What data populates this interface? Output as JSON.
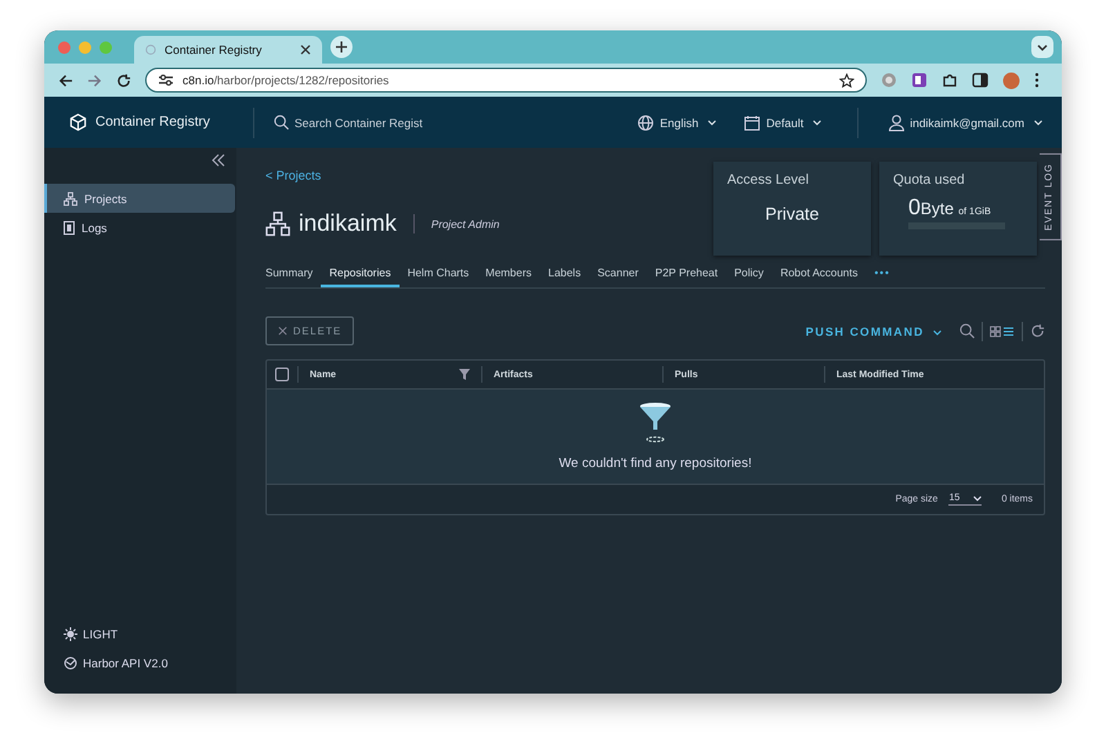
{
  "browser": {
    "tab_title": "Container Registry",
    "url_domain": "c8n.io",
    "url_path": "/harbor/projects/1282/repositories"
  },
  "header": {
    "app_name": "Container Registry",
    "search": {
      "placeholder": "Search Container Regist"
    },
    "language": "English",
    "theme_menu": "Default",
    "user": "indikaimk@gmail.com"
  },
  "sidebar": {
    "items": [
      {
        "label": "Projects",
        "selected": true
      },
      {
        "label": "Logs",
        "selected": false
      }
    ],
    "footer": [
      {
        "label": "LIGHT"
      },
      {
        "label": "Harbor API V2.0"
      }
    ]
  },
  "event_log": "EVENT LOG",
  "breadcrumb": "< Projects",
  "project": {
    "name": "indikaimk",
    "role": "Project Admin"
  },
  "cards": {
    "access": {
      "title": "Access Level",
      "value": "Private"
    },
    "quota": {
      "title": "Quota used",
      "amount": "0",
      "unit": "Byte",
      "of": "of 1GiB"
    }
  },
  "tabs": [
    {
      "label": "Summary",
      "selected": false
    },
    {
      "label": "Repositories",
      "selected": true
    },
    {
      "label": "Helm Charts",
      "selected": false
    },
    {
      "label": "Members",
      "selected": false
    },
    {
      "label": "Labels",
      "selected": false
    },
    {
      "label": "Scanner",
      "selected": false
    },
    {
      "label": "P2P Preheat",
      "selected": false
    },
    {
      "label": "Policy",
      "selected": false
    },
    {
      "label": "Robot Accounts",
      "selected": false
    },
    {
      "label": "•••",
      "selected": false
    }
  ],
  "toolbar": {
    "delete": "DELETE",
    "push_command": "PUSH COMMAND"
  },
  "table": {
    "select_all_checked": false,
    "columns": [
      "Name",
      "Artifacts",
      "Pulls",
      "Last Modified Time"
    ],
    "empty_message": "We couldn't find any repositories!",
    "footer": {
      "page_size_label": "Page size",
      "page_size": "15",
      "total": "0 items"
    }
  }
}
